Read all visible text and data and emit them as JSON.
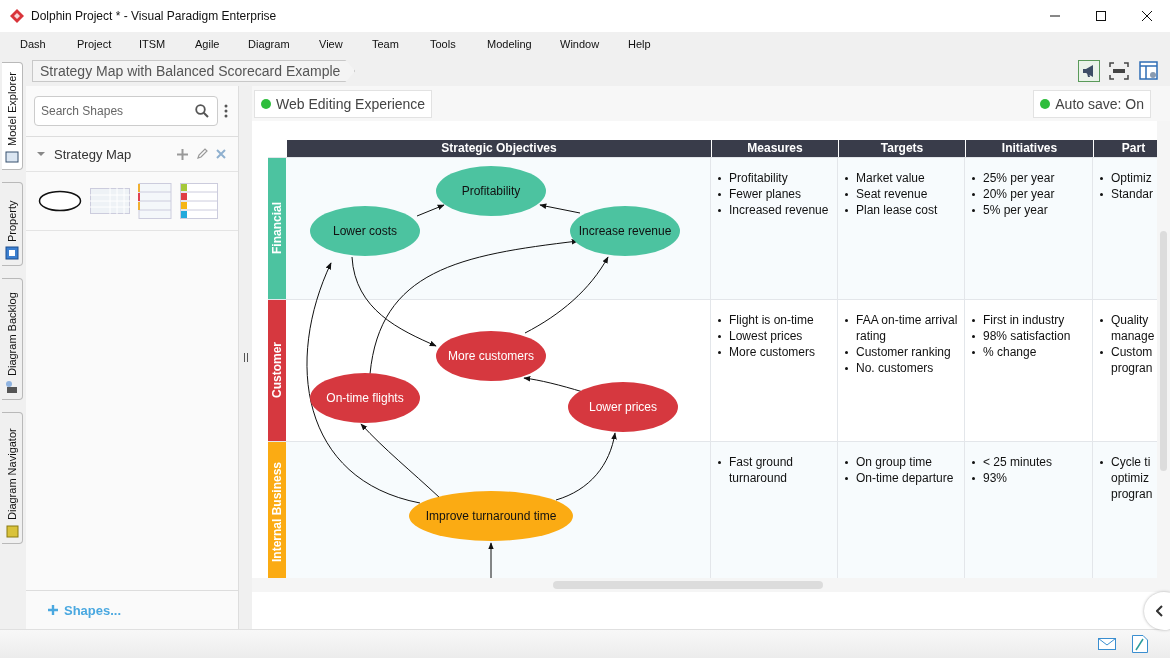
{
  "window": {
    "title": "Dolphin Project * - Visual Paradigm Enterprise"
  },
  "menu": [
    "Dash",
    "Project",
    "ITSM",
    "Agile",
    "Diagram",
    "View",
    "Team",
    "Tools",
    "Modeling",
    "Window",
    "Help"
  ],
  "side_tabs": [
    {
      "label": "Model Explorer",
      "selected": true
    },
    {
      "label": "Property",
      "selected": false
    },
    {
      "label": "Diagram Backlog",
      "selected": false
    },
    {
      "label": "Diagram Navigator",
      "selected": false
    }
  ],
  "breadcrumb": "Strategy Map with Balanced Scorecard Example",
  "toolbar": [
    {
      "kind": "megaphone",
      "selected": true
    },
    {
      "kind": "fit",
      "selected": false
    },
    {
      "kind": "layout",
      "selected": false
    }
  ],
  "search": {
    "placeholder": "Search Shapes"
  },
  "palette": {
    "title": "Strategy Map",
    "expanded": true,
    "shapes_link": "Shapes..."
  },
  "web_editing": {
    "label": "Web Editing Experience",
    "color": "#2ebd3c"
  },
  "autosave": {
    "label": "Auto save: On",
    "color": "#2ebd3c"
  },
  "diagram": {
    "columns": [
      "Strategic Objectives",
      "Measures",
      "Targets",
      "Initiatives",
      "Part"
    ],
    "rows": [
      {
        "perspective": "Financial",
        "color": "#4cc3a0",
        "objectives": [
          "Profitability",
          "Lower costs",
          "Increase revenue"
        ],
        "measures": [
          "Profitability",
          "Fewer planes",
          "Increased revenue"
        ],
        "targets": [
          "Market value",
          "Seat revenue",
          "Plan lease cost"
        ],
        "initiatives": [
          "25% per year",
          "20% per year",
          "5% per year"
        ],
        "column_5": [
          "Optimiz",
          "Standar"
        ]
      },
      {
        "perspective": "Customer",
        "color": "#d6383f",
        "objectives": [
          "More customers",
          "On-time flights",
          "Lower prices"
        ],
        "measures": [
          "Flight is on-time",
          "Lowest prices",
          "More customers"
        ],
        "targets": [
          "FAA on-time arrival rating",
          "Customer ranking",
          "No. customers"
        ],
        "initiatives": [
          "First in industry",
          "98% satisfaction",
          "% change"
        ],
        "column_5": [
          "Quality manage",
          "Custom progran"
        ]
      },
      {
        "perspective": "Internal Business",
        "color": "#fbab13",
        "objectives": [
          "Improve turnaround time"
        ],
        "measures": [
          "Fast ground turnaround"
        ],
        "targets": [
          "On group time",
          "On-time departure"
        ],
        "initiatives": [
          "< 25 minutes",
          "93%"
        ],
        "column_5": [
          "Cycle ti optimiz progran"
        ]
      }
    ]
  }
}
